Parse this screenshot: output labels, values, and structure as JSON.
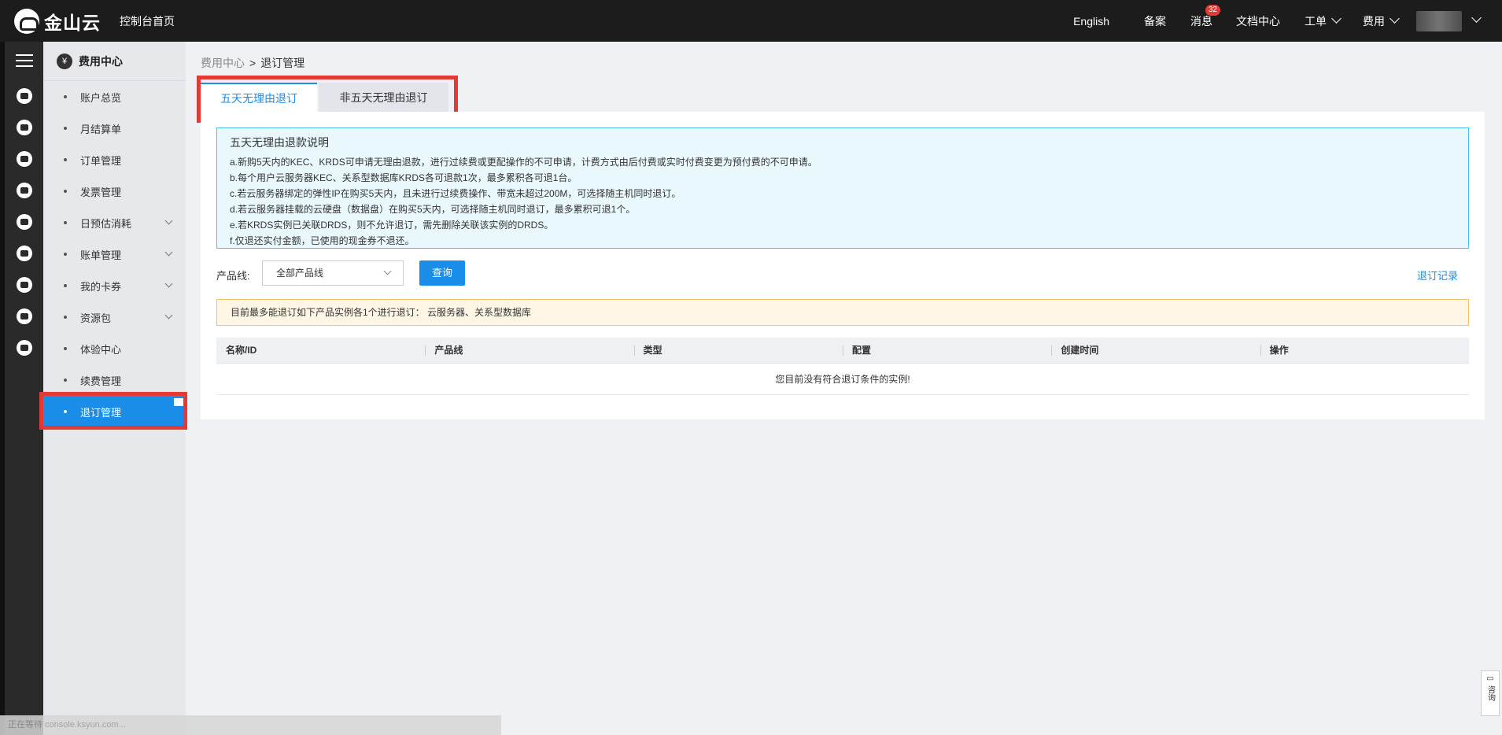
{
  "header": {
    "logo_text": "金山云",
    "console_home": "控制台首页",
    "links": {
      "english": "English",
      "beian": "备案",
      "messages": "消息",
      "messages_badge": "32",
      "docs": "文档中心",
      "ticket": "工单",
      "fee": "费用"
    }
  },
  "sidebar": {
    "title": "费用中心",
    "items": [
      {
        "label": "账户总览"
      },
      {
        "label": "月结算单"
      },
      {
        "label": "订单管理"
      },
      {
        "label": "发票管理"
      },
      {
        "label": "日预估消耗"
      },
      {
        "label": "账单管理"
      },
      {
        "label": "我的卡券"
      },
      {
        "label": "资源包"
      },
      {
        "label": "体验中心"
      },
      {
        "label": "续费管理"
      },
      {
        "label": "退订管理"
      }
    ]
  },
  "breadcrumb": {
    "parent": "费用中心",
    "separator": ">",
    "current": "退订管理"
  },
  "tabs": [
    "五天无理由退订",
    "非五天无理由退订"
  ],
  "notice": {
    "title": "五天无理由退款说明",
    "lines": [
      "a.新购5天内的KEC、KRDS可申请无理由退款，进行过续费或更配操作的不可申请，计费方式由后付费或实时付费变更为预付费的不可申请。",
      "b.每个用户云服务器KEC、关系型数据库KRDS各可退款1次，最多累积各可退1台。",
      "c.若云服务器绑定的弹性IP在购买5天内，且未进行过续费操作、带宽未超过200M，可选择随主机同时退订。",
      "d.若云服务器挂载的云硬盘（数据盘）在购买5天内，可选择随主机同时退订，最多累积可退1个。",
      "e.若KRDS实例已关联DRDS，则不允许退订，需先删除关联该实例的DRDS。",
      "f.仅退还实付金额，已使用的现金券不退还。"
    ]
  },
  "filter": {
    "label": "产品线:",
    "select_value": "全部产品线",
    "query_button": "查询",
    "record_link": "退订记录"
  },
  "warning": "目前最多能退订如下产品实例各1个进行退订： 云服务器、关系型数据库",
  "table": {
    "columns": [
      "名称/ID",
      "产品线",
      "类型",
      "配置",
      "创建时间",
      "操作"
    ],
    "empty_text": "您目前没有符合退订条件的实例!"
  },
  "consult": "咨询",
  "status_bar": "正在等待 console.ksyun.com..."
}
